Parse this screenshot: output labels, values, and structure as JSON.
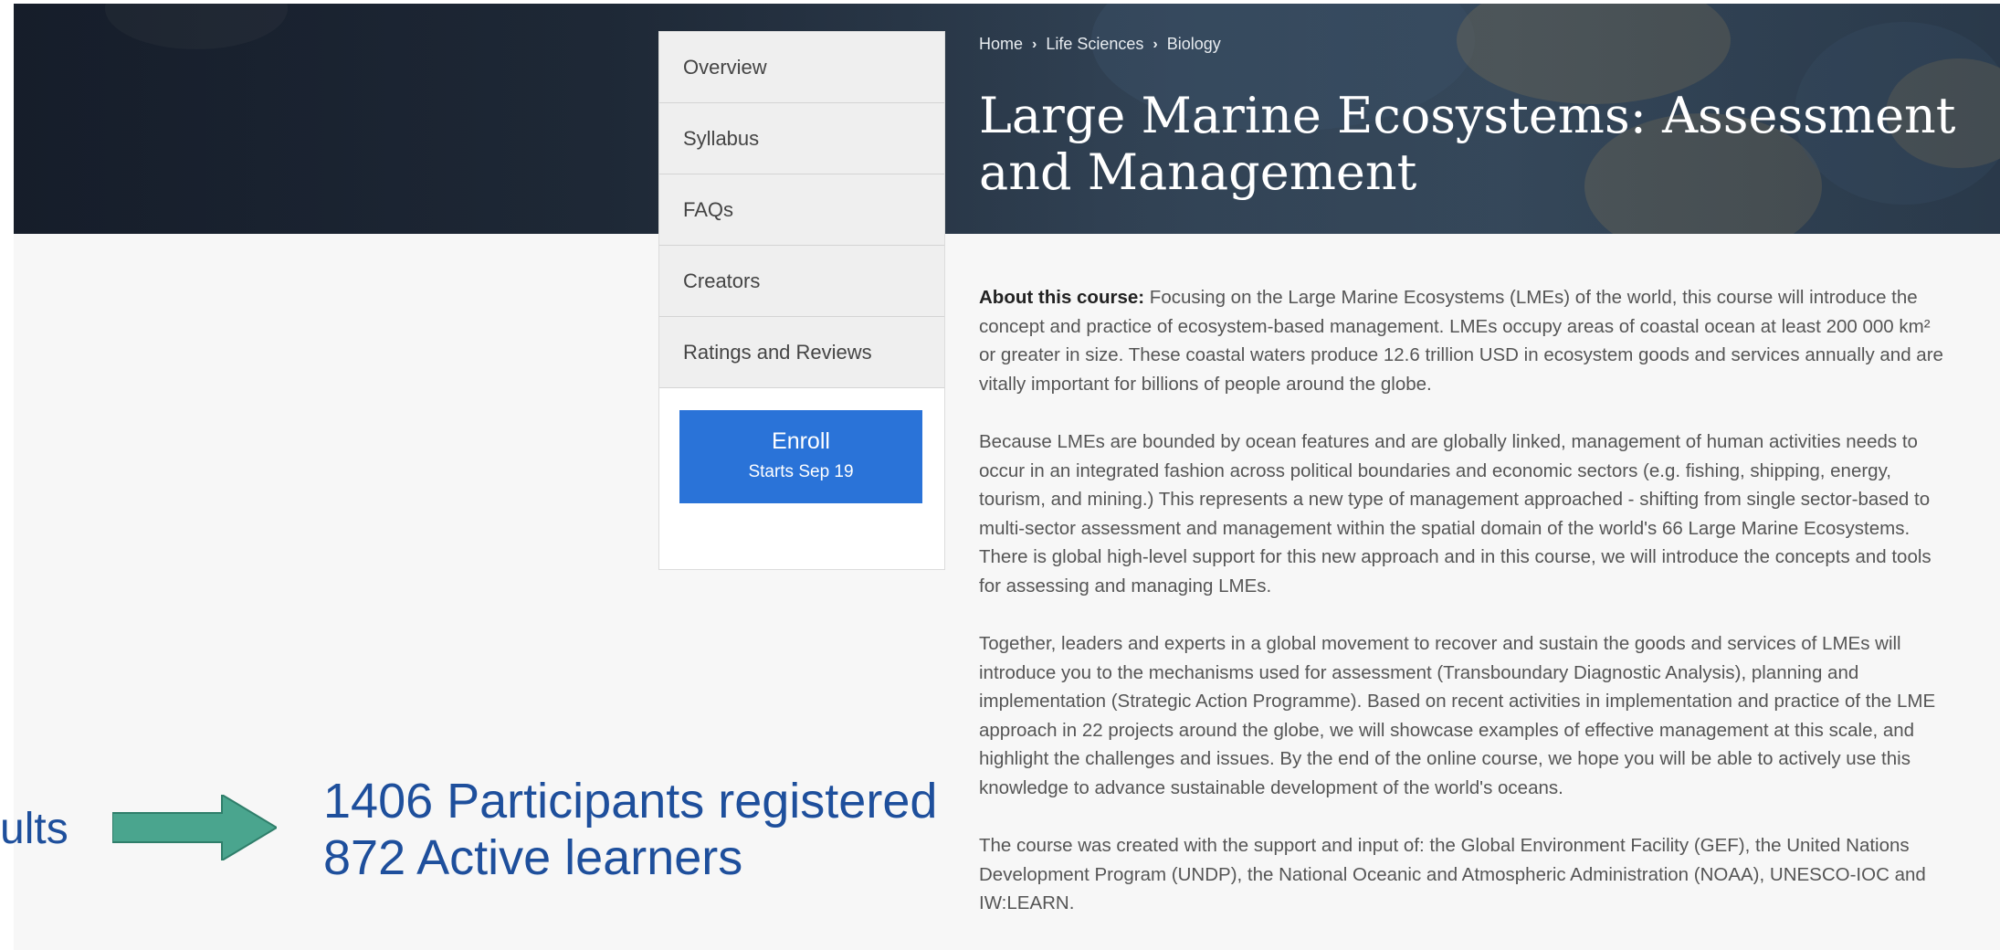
{
  "breadcrumb": {
    "items": [
      "Home",
      "Life Sciences",
      "Biology"
    ]
  },
  "course": {
    "title": "Large Marine Ecosystems: Assessment and Management"
  },
  "nav": {
    "items": [
      "Overview",
      "Syllabus",
      "FAQs",
      "Creators",
      "Ratings and Reviews"
    ],
    "enroll_label": "Enroll",
    "enroll_sub": "Starts Sep 19"
  },
  "about": {
    "heading": "About this course:",
    "p1": "Focusing on the Large Marine Ecosystems (LMEs) of the world, this course will introduce the concept and practice of ecosystem-based management. LMEs occupy areas of coastal ocean at least 200 000 km² or greater in size. These coastal waters produce 12.6 trillion USD in ecosystem goods and services annually and are vitally important for billions of people around the globe.",
    "p2": "Because LMEs are bounded by ocean features and are globally linked, management of human activities needs to occur in an integrated fashion across political boundaries and economic sectors (e.g. fishing, shipping, energy, tourism, and mining.) This represents a new type of management approached - shifting from single sector-based to multi-sector assessment and management within the spatial domain of the world's 66 Large Marine Ecosystems. There is global high-level support for this new approach and in this course, we will introduce the concepts and tools for assessing and managing LMEs.",
    "p3": "Together, leaders and experts in a global movement to recover and sustain the goods and services of LMEs will introduce you to the mechanisms used for assessment (Transboundary Diagnostic Analysis), planning and implementation (Strategic Action Programme). Based on recent activities in implementation and practice of the LME approach in 22 projects around the globe, we will showcase examples of effective management at this scale, and highlight the challenges and issues. By the end of the online course, we hope you will be able to actively use this knowledge to advance sustainable development of the world's oceans.",
    "p4": "The course was created with the support and input of: the Global Environment Facility (GEF), the United Nations Development Program (UNDP), the National Oceanic and Atmospheric Administration (NOAA), UNESCO-IOC and IW:LEARN."
  },
  "overlay": {
    "left_text": "ults",
    "arrow_color": "#4aa58e",
    "text_color": "#1e4f9c",
    "participants": "1406 Participants registered",
    "learners": "872 Active learners"
  },
  "colors": {
    "enroll_bg": "#2a73d8"
  }
}
